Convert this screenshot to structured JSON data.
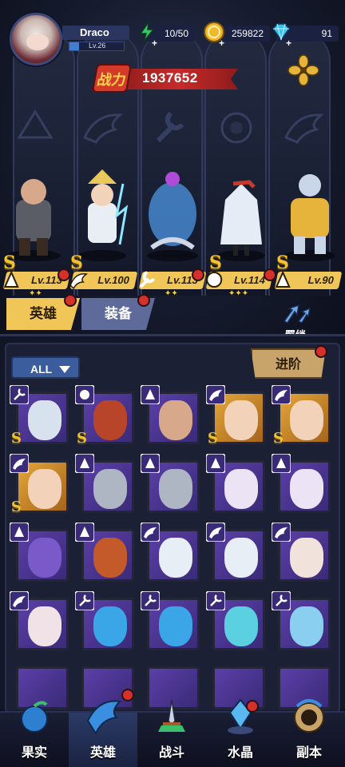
{
  "player": {
    "name": "Draco",
    "level": "Lv.26"
  },
  "resources": {
    "energy": "10/50",
    "gold": "259822",
    "gems": "91"
  },
  "power": {
    "label": "战力",
    "value": "1937652"
  },
  "team": [
    {
      "level": "Lv.113",
      "tier": "S",
      "class": "mage-icon",
      "dot": true
    },
    {
      "level": "Lv.100",
      "tier": "S",
      "class": "wing-icon",
      "dot": false
    },
    {
      "level": "Lv.113",
      "tier": "",
      "class": "wrench-icon",
      "dot": true
    },
    {
      "level": "Lv.114",
      "tier": "S",
      "class": "beast-icon",
      "dot": true
    },
    {
      "level": "Lv.90",
      "tier": "S",
      "class": "mage-icon",
      "dot": false
    }
  ],
  "tabs": {
    "heroes": "英雄",
    "equipment": "装备"
  },
  "bond_label": "羁绊",
  "filter_label": "ALL",
  "advance_label": "进阶",
  "nav": [
    {
      "label": "果实",
      "icon": "fruit-icon"
    },
    {
      "label": "英雄",
      "icon": "hero-icon"
    },
    {
      "label": "战斗",
      "icon": "battle-icon"
    },
    {
      "label": "水晶",
      "icon": "crystal-icon"
    },
    {
      "label": "副本",
      "icon": "dungeon-icon"
    }
  ]
}
